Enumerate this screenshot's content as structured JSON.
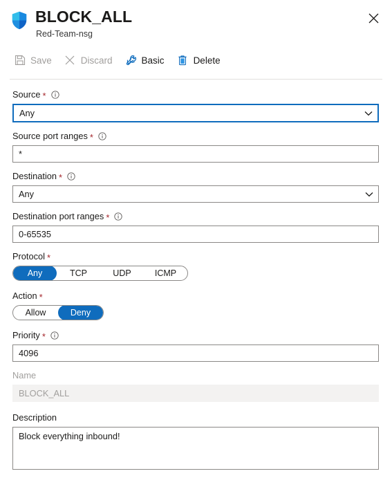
{
  "header": {
    "icon": "shield-icon",
    "title": "BLOCK_ALL",
    "subtitle": "Red-Team-nsg",
    "close_label": "close-icon"
  },
  "toolbar": {
    "items": [
      {
        "label": "Save",
        "icon": "save-icon",
        "disabled": true
      },
      {
        "label": "Discard",
        "icon": "discard-icon",
        "disabled": true
      },
      {
        "label": "Basic",
        "icon": "wrench-icon",
        "disabled": false
      },
      {
        "label": "Delete",
        "icon": "trash-icon",
        "disabled": false
      }
    ]
  },
  "form": {
    "source": {
      "label": "Source",
      "required": true,
      "info": true,
      "value": "Any",
      "type": "dropdown",
      "focused": true
    },
    "source_port_ranges": {
      "label": "Source port ranges",
      "required": true,
      "info": true,
      "value": "*",
      "type": "text"
    },
    "destination": {
      "label": "Destination",
      "required": true,
      "info": true,
      "value": "Any",
      "type": "dropdown"
    },
    "destination_port_ranges": {
      "label": "Destination port ranges",
      "required": true,
      "info": true,
      "value": "0-65535",
      "type": "text"
    },
    "protocol": {
      "label": "Protocol",
      "required": true,
      "info": false,
      "options": [
        "Any",
        "TCP",
        "UDP",
        "ICMP"
      ],
      "selected": "Any",
      "type": "pill-group"
    },
    "action": {
      "label": "Action",
      "required": true,
      "info": false,
      "options": [
        "Allow",
        "Deny"
      ],
      "selected": "Deny",
      "type": "pill-group"
    },
    "priority": {
      "label": "Priority",
      "required": true,
      "info": true,
      "value": "4096",
      "type": "text"
    },
    "name": {
      "label": "Name",
      "required": false,
      "info": false,
      "value": "BLOCK_ALL",
      "type": "text",
      "disabled": true
    },
    "description": {
      "label": "Description",
      "required": false,
      "info": false,
      "value": "Block everything inbound!",
      "type": "textarea"
    }
  },
  "colors": {
    "accent": "#0f6cbd",
    "required_asterisk": "#a4262c",
    "border": "#8a8886",
    "disabled_bg": "#f3f2f1",
    "disabled_text": "#a19f9d"
  }
}
